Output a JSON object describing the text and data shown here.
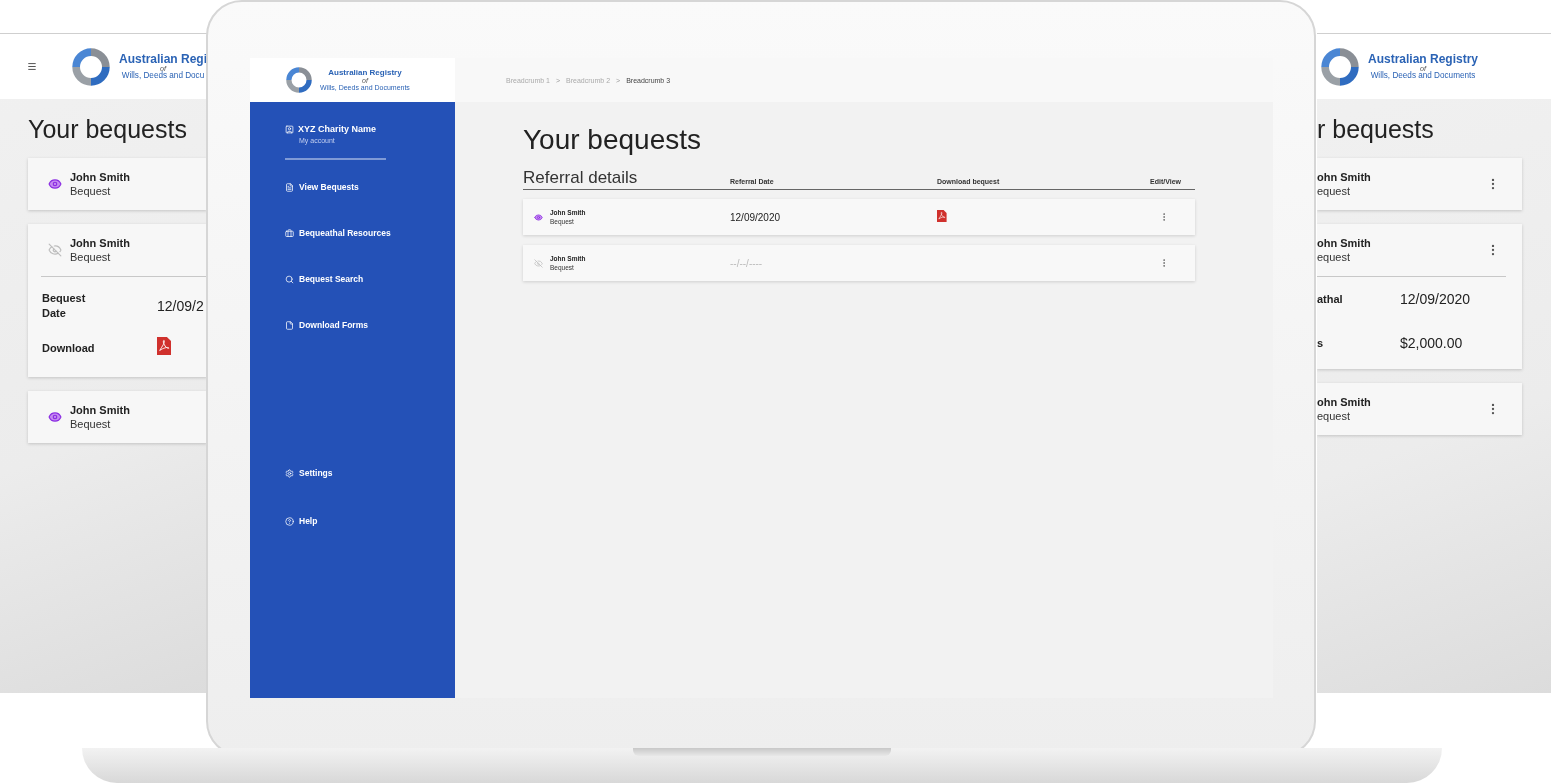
{
  "left_phone": {
    "logo": {
      "title": "Australian Regi",
      "of": "of",
      "subtitle": "Wills, Deeds and Docu"
    },
    "title": "Your bequests",
    "cards": [
      {
        "name": "John Smith",
        "type": "Bequest",
        "seen": true,
        "expanded": false
      },
      {
        "name": "John Smith",
        "type": "Bequest",
        "seen": false,
        "expanded": true,
        "details": [
          {
            "kind": "text",
            "label": "Bequest Date",
            "value": "12/09/2"
          },
          {
            "kind": "pdf",
            "label": "Download"
          }
        ]
      },
      {
        "name": "John Smith",
        "type": "Bequest",
        "seen": true,
        "expanded": false
      }
    ]
  },
  "laptop": {
    "logo": {
      "title": "Australian Registry",
      "of": "of",
      "subtitle": "Wills, Deeds and Documents"
    },
    "account": {
      "name": "XYZ Charity Name",
      "sub": "My account"
    },
    "nav": [
      {
        "kind": "view",
        "label": "View Bequests"
      },
      {
        "kind": "resources",
        "label": "Bequeathal Resources"
      },
      {
        "kind": "search",
        "label": "Bequest Search"
      },
      {
        "kind": "forms",
        "label": "Download Forms"
      }
    ],
    "nav_bottom": [
      {
        "kind": "settings",
        "label": "Settings"
      },
      {
        "kind": "help",
        "label": "Help"
      }
    ],
    "breadcrumbs": [
      {
        "label": "Breadcrumb 1",
        "selected": false
      },
      {
        "label": "Breadcrumb 2",
        "selected": false
      },
      {
        "label": "Breadcrumb 3",
        "selected": true
      }
    ],
    "separator": ">",
    "title": "Your bequests",
    "table": {
      "columns": [
        "Referral details",
        "Referral Date",
        "Download bequest",
        "Edit/View"
      ],
      "rows": [
        {
          "name": "John Smith",
          "type": "Bequest",
          "seen": true,
          "date": "12/09/2020",
          "pending": false,
          "pdf": true
        },
        {
          "name": "John Smith",
          "type": "Bequest",
          "seen": false,
          "date": "--/--/----",
          "pending": true,
          "pdf": false
        }
      ]
    }
  },
  "right_phone": {
    "logo": {
      "title": "Australian Registry",
      "of": "of",
      "subtitle": "Wills, Deeds and Documents"
    },
    "title": "r bequests",
    "cards": [
      {
        "name": "ohn Smith",
        "type": "equest",
        "expanded": false
      },
      {
        "name": "ohn Smith",
        "type": "equest",
        "expanded": true,
        "details": [
          {
            "kind": "text",
            "label": "athal",
            "value": "12/09/2020"
          },
          {
            "kind": "text",
            "label": "s",
            "value": "$2,000.00"
          }
        ]
      },
      {
        "name": "ohn Smith",
        "type": "equest",
        "expanded": false
      }
    ]
  }
}
